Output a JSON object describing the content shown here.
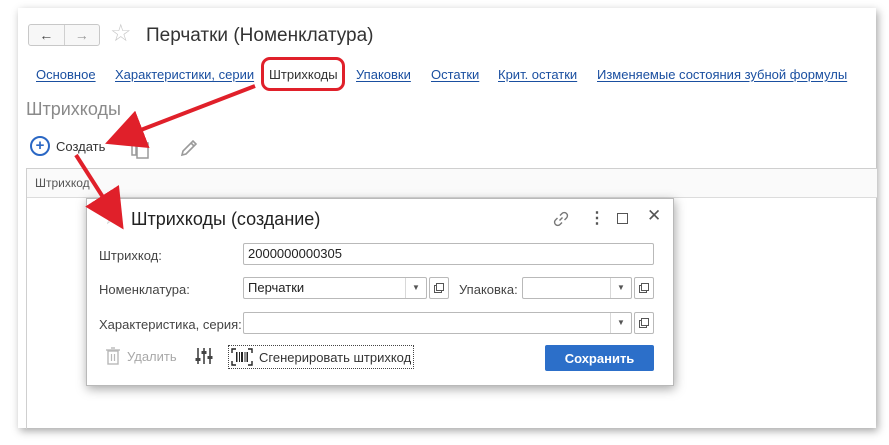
{
  "window": {
    "back_glyph": "←",
    "forward_glyph": "→",
    "favorite_glyph": "☆",
    "title": "Перчатки (Номенклатура)"
  },
  "tabs": [
    {
      "label": "Основное",
      "active": false
    },
    {
      "label": "Характеристики, серии",
      "active": false
    },
    {
      "label": "Штрихкоды",
      "active": true
    },
    {
      "label": "Упаковки",
      "active": false
    },
    {
      "label": "Остатки",
      "active": false
    },
    {
      "label": "Крит. остатки",
      "active": false
    },
    {
      "label": "Изменяемые состояния зубной формулы",
      "active": false
    }
  ],
  "section": {
    "title": "Штрихкоды",
    "create_label": "Создать",
    "column_header": "Штрихкод"
  },
  "dialog": {
    "favorite_glyph": "☆",
    "title": "Штрихкоды (создание)",
    "barcode_label": "Штрихкод:",
    "barcode_value": "2000000000305",
    "nomenclature_label": "Номенклатура:",
    "nomenclature_value": "Перчатки",
    "package_label": "Упаковка:",
    "package_value": "",
    "characteristic_label": "Характеристика, серия:",
    "characteristic_value": "",
    "delete_label": "Удалить",
    "generate_label": "Сгенерировать штрихкод",
    "save_label": "Сохранить",
    "close_glyph": "✕",
    "more_glyph": "⋮"
  },
  "colors": {
    "link": "#1a4fa0",
    "accent": "#2c6fc9",
    "annotation": "#e0202a"
  },
  "icons": [
    "back-arrow-icon",
    "forward-arrow-icon",
    "star-icon",
    "plus-circle-icon",
    "copy-icon",
    "pencil-icon",
    "link-icon",
    "more-vertical-icon",
    "maximize-icon",
    "close-icon",
    "dropdown-arrow-icon",
    "open-form-icon",
    "trash-icon",
    "settings-sliders-icon",
    "barcode-icon"
  ]
}
